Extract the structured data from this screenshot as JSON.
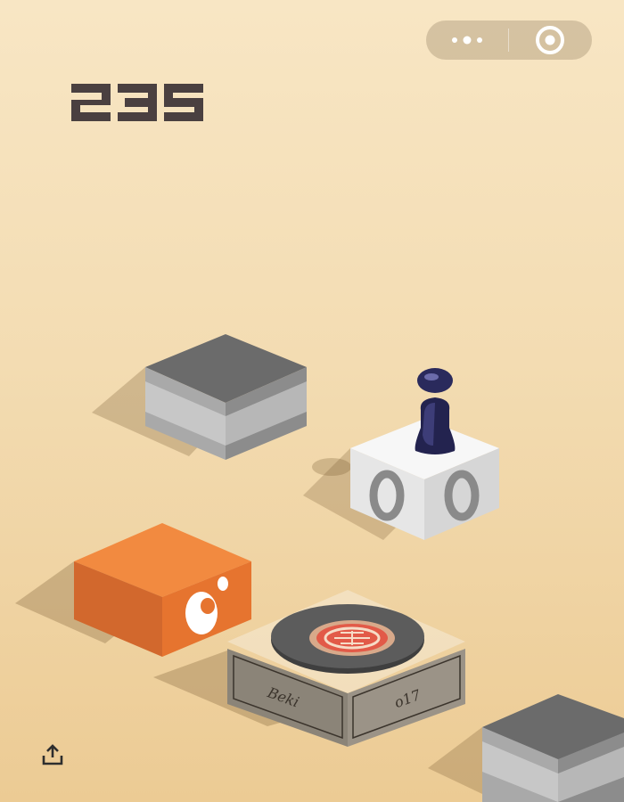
{
  "hud": {
    "score": "235",
    "menu_icon": "more-dots-icon",
    "close_icon": "target-close-icon",
    "share_icon": "share-upload-icon"
  },
  "board": {
    "plate_text_left": "Beki",
    "plate_text_right": "o17"
  },
  "colors": {
    "background_top": "#f8e6c4",
    "background_bottom": "#eccb94",
    "gray_block_top": "#6b6b6b",
    "orange_block": "#f07d35",
    "white_block": "#f4f4f4",
    "piece": "#2a2a5c",
    "score_text": "#4a4040"
  }
}
